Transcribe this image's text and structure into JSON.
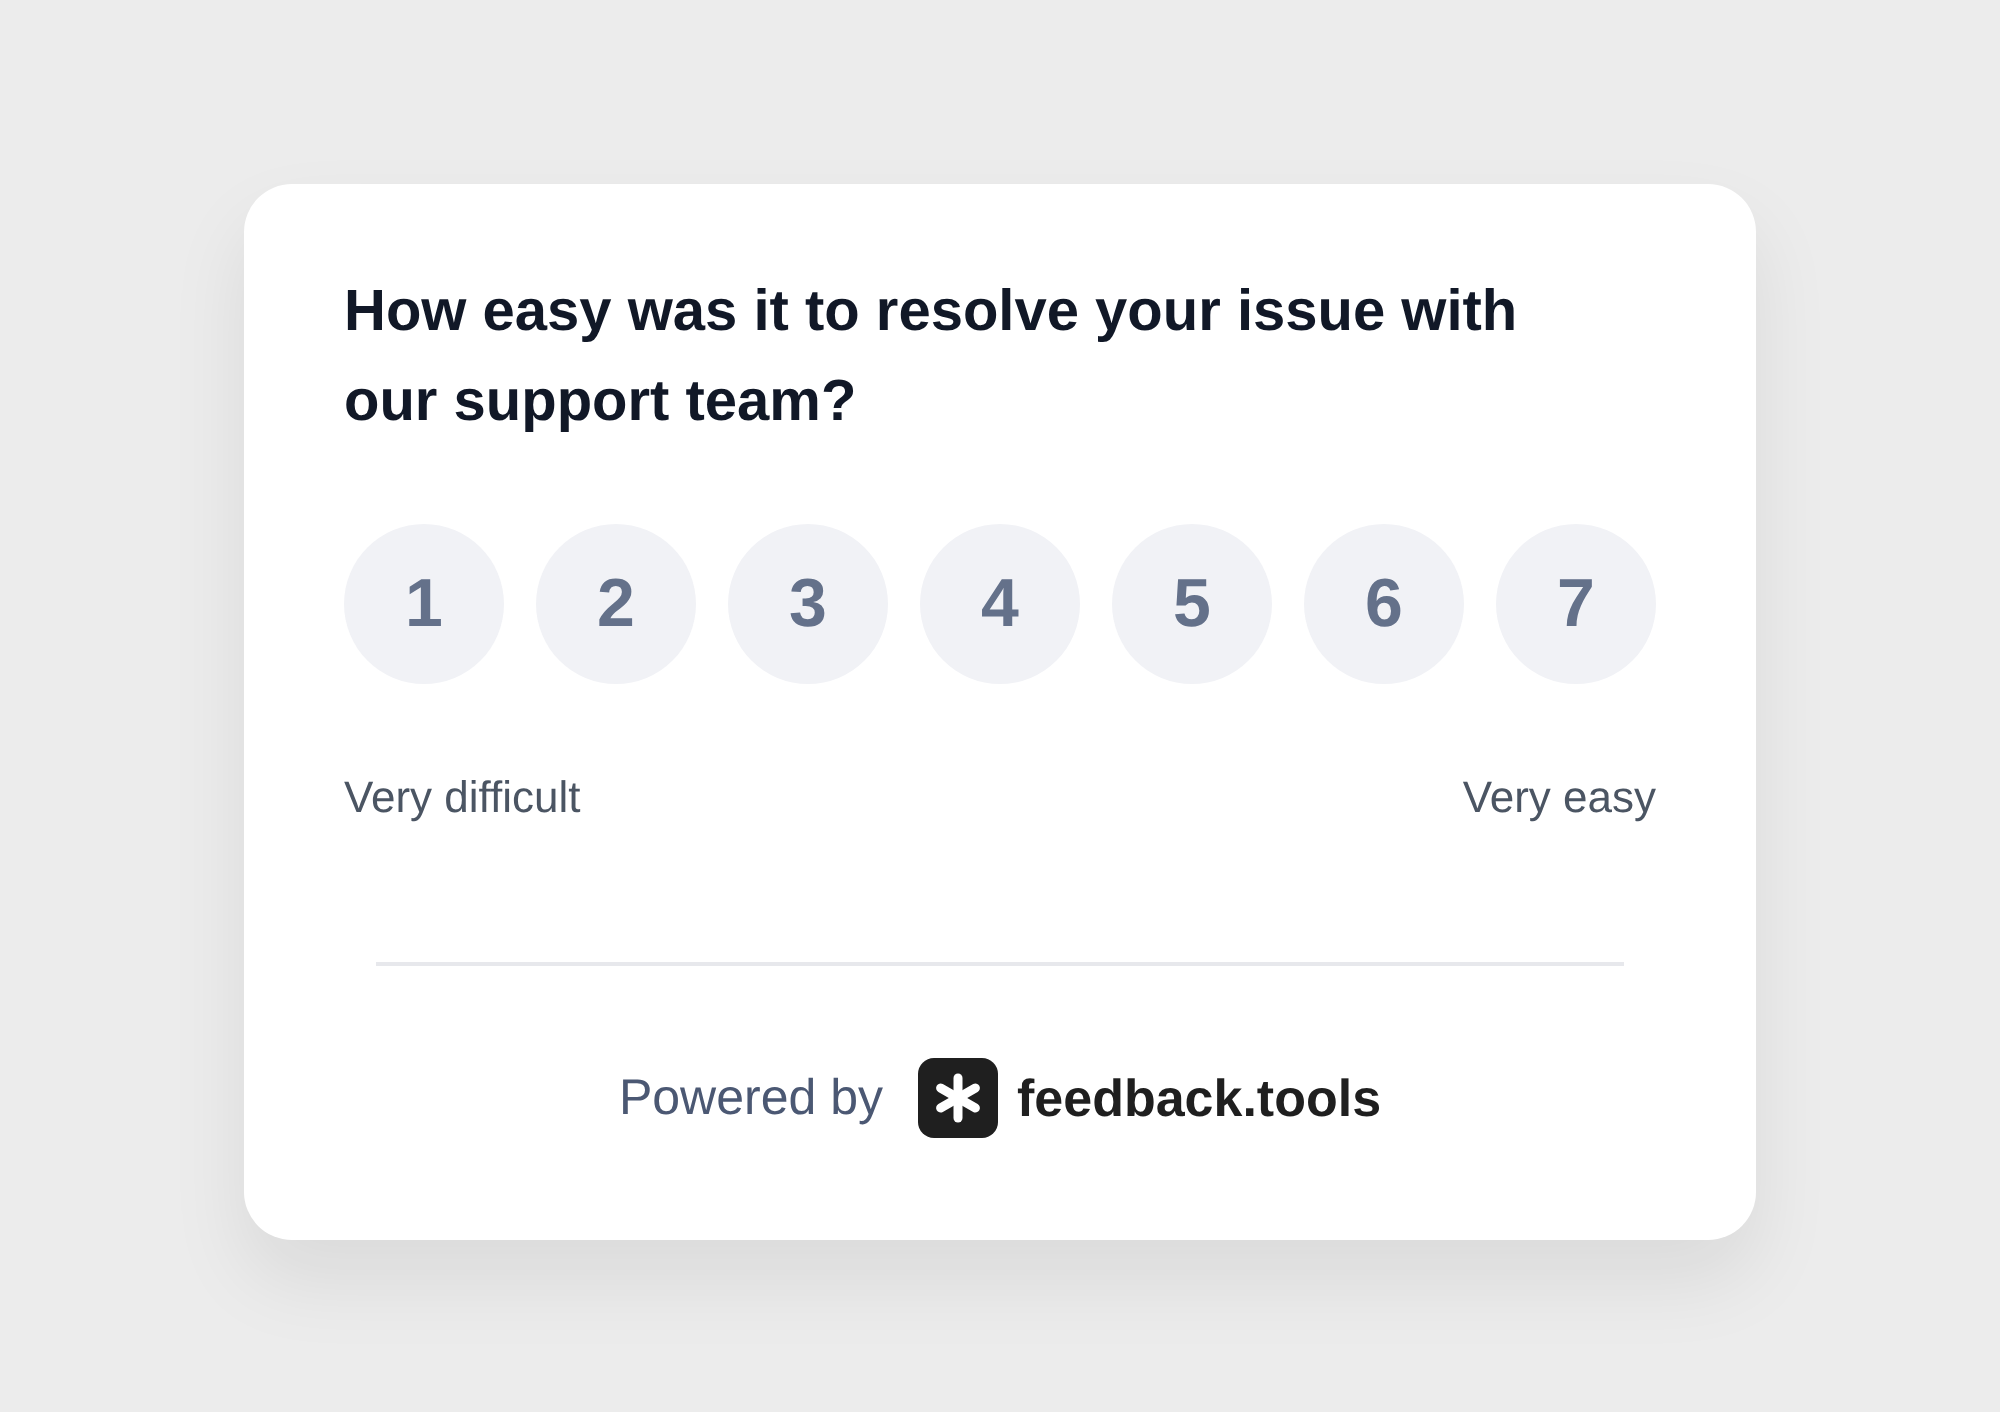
{
  "question": "How easy was it to resolve your issue with our support team?",
  "options": [
    {
      "label": "1",
      "selected": false
    },
    {
      "label": "2",
      "selected": false
    },
    {
      "label": "3",
      "selected": false
    },
    {
      "label": "4",
      "selected": false
    },
    {
      "label": "5",
      "selected": false
    },
    {
      "label": "6",
      "selected": false
    },
    {
      "label": "7",
      "selected": false
    }
  ],
  "scale_labels": {
    "low": "Very difficult",
    "high": "Very easy"
  },
  "footer": {
    "prefix": "Powered by",
    "brand": "feedback.tools"
  }
}
